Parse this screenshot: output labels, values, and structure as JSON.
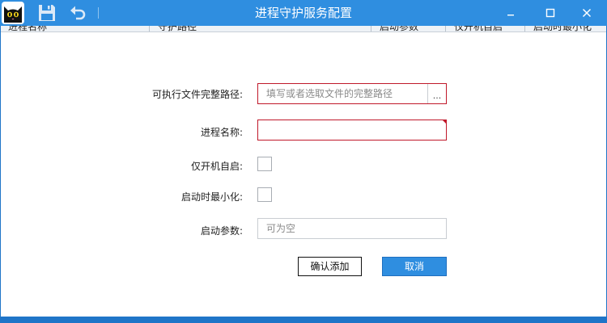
{
  "window": {
    "title": "进程守护服务配置",
    "titlebar_color": "#2f8ee0"
  },
  "toolbar": {
    "icons": [
      "app-cat-icon",
      "save-icon",
      "undo-icon"
    ]
  },
  "grid_header": {
    "columns": [
      "进程名称",
      "守护路径",
      "启动参数",
      "仅开机自启",
      "启动时最小化"
    ]
  },
  "form": {
    "exe_path": {
      "label": "可执行文件完整路径:",
      "placeholder": "填写或者选取文件的完整路径",
      "value": "",
      "browse_label": "..."
    },
    "process_name": {
      "label": "进程名称:",
      "value": ""
    },
    "boot_only": {
      "label": "仅开机自启:",
      "checked": false
    },
    "start_minimized": {
      "label": "启动时最小化:",
      "checked": false
    },
    "start_args": {
      "label": "启动参数:",
      "placeholder": "可为空",
      "value": ""
    }
  },
  "buttons": {
    "confirm_label": "确认添加",
    "cancel_label": "取消"
  },
  "colors": {
    "required_border": "#c0182a",
    "accent": "#2f8ee0"
  }
}
